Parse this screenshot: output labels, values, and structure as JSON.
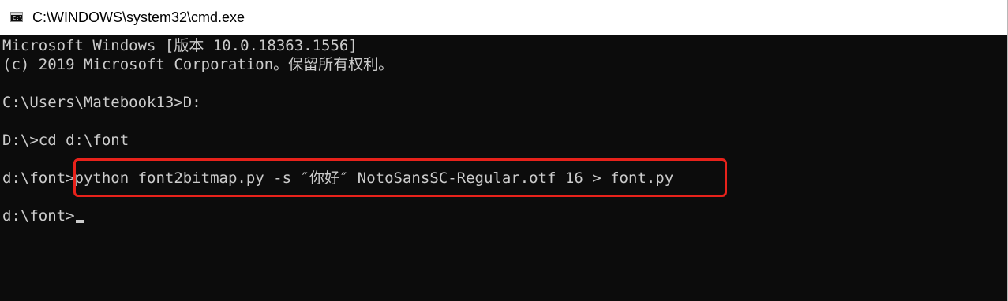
{
  "window": {
    "title": "C:\\WINDOWS\\system32\\cmd.exe",
    "icon": "cmd-console-icon",
    "icon_prompt": "C:\\"
  },
  "console": {
    "lines": [
      "Microsoft Windows [版本 10.0.18363.1556]",
      "(c) 2019 Microsoft Corporation。保留所有权利。",
      "",
      "C:\\Users\\Matebook13>D:",
      "",
      "D:\\>cd d:\\font",
      "",
      "d:\\font>python font2bitmap.py -s ″你好″ NotoSansSC-Regular.otf 16 > font.py",
      "",
      "d:\\font>"
    ]
  },
  "colors": {
    "console_bg": "#0c0c0c",
    "console_text": "#cccccc",
    "highlight_border": "#e8221b",
    "titlebar_bg": "#ffffff"
  }
}
